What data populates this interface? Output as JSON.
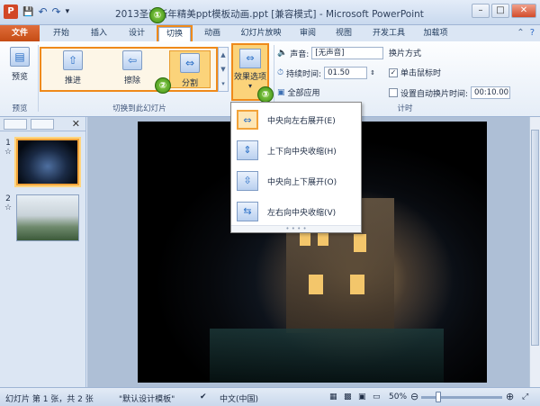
{
  "window": {
    "title": "2013圣诞新年精美ppt模板动画.ppt [兼容模式] - Microsoft PowerPoint",
    "controls": {
      "minimize": "–",
      "maximize": "□",
      "close": "✕"
    }
  },
  "quick_access": {
    "logo": "P",
    "save": "💾",
    "undo": "↶",
    "redo": "↷",
    "customize": "▾"
  },
  "tabs": [
    {
      "label": "文件"
    },
    {
      "label": "开始"
    },
    {
      "label": "插入"
    },
    {
      "label": "设计"
    },
    {
      "label": "切换"
    },
    {
      "label": "动画"
    },
    {
      "label": "幻灯片放映"
    },
    {
      "label": "审阅"
    },
    {
      "label": "视图"
    },
    {
      "label": "开发工具"
    },
    {
      "label": "加载项"
    }
  ],
  "ribbon": {
    "preview": {
      "label": "预览",
      "group": "预览"
    },
    "transitions": [
      {
        "label": "推进",
        "icon": "push-icon",
        "glyph": "⇧"
      },
      {
        "label": "擦除",
        "icon": "wipe-icon",
        "glyph": "⇦"
      },
      {
        "label": "分割",
        "icon": "split-icon",
        "glyph": "⇔"
      }
    ],
    "transitions_group": "切换到此幻灯片",
    "effect_options": {
      "label": "效果选项",
      "arrow": "▾"
    },
    "timing": {
      "sound_label": "声音:",
      "sound_value": "[无声音]",
      "duration_label": "持续时间:",
      "duration_value": "01.50",
      "apply_all": "全部应用",
      "advance_title": "换片方式",
      "on_click": "单击鼠标时",
      "on_click_checked": true,
      "auto_label": "设置自动换片时间:",
      "auto_value": "00:10.00",
      "group": "计时"
    }
  },
  "callouts": [
    "①",
    "②",
    "③"
  ],
  "dropdown": {
    "items": [
      {
        "label": "中央向左右展开(E)",
        "glyph": "⇔",
        "selected": true
      },
      {
        "label": "上下向中央收缩(H)",
        "glyph": "⇕",
        "selected": false
      },
      {
        "label": "中央向上下展开(O)",
        "glyph": "⇳",
        "selected": false
      },
      {
        "label": "左右向中央收缩(V)",
        "glyph": "⇆",
        "selected": false
      }
    ]
  },
  "slides_pane": {
    "close": "✕",
    "slides": [
      {
        "number": "1",
        "star": "☆"
      },
      {
        "number": "2",
        "star": "☆"
      }
    ]
  },
  "status": {
    "slide_info": "幻灯片 第 1 张，共 2 张",
    "theme": "\"默认设计模板\"",
    "language": "中文(中国)",
    "zoom": "50%",
    "zoom_out": "⊖",
    "zoom_in": "⊕"
  },
  "colors": {
    "accent": "#ef8a1a",
    "file_tab": "#c54c14",
    "callout": "#3c8f14"
  }
}
